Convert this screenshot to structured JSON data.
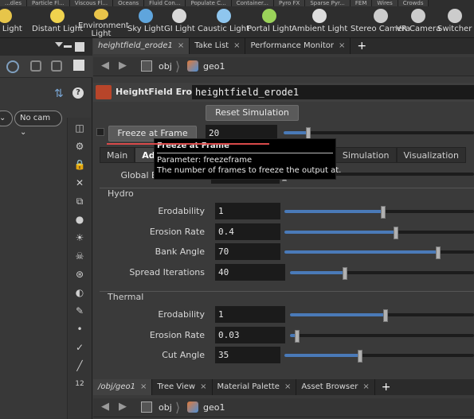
{
  "shelf": {
    "tabs": [
      "...dles",
      "Particle Fl...",
      "Viscous Fl...",
      "Oceans",
      "Fluid Con...",
      "Populate C...",
      "Container...",
      "Pyro FX",
      "Sparse Pyr...",
      "FEM",
      "Wires",
      "Crowds"
    ],
    "tools": [
      {
        "label": "...e Light",
        "icon": "point-light-icon",
        "color": "#e7c54a"
      },
      {
        "label": "Distant Light",
        "icon": "distant-light-icon",
        "color": "#f0d34e"
      },
      {
        "label": "Environment Light",
        "icon": "environment-light-icon",
        "color": "#e9c44a"
      },
      {
        "label": "Sky Light",
        "icon": "sky-light-icon",
        "color": "#5fa5dd"
      },
      {
        "label": "GI Light",
        "icon": "gi-light-icon",
        "color": "#d8d8d8"
      },
      {
        "label": "Caustic Light",
        "icon": "caustic-light-icon",
        "color": "#8fc6ee"
      },
      {
        "label": "Portal Light",
        "icon": "portal-light-icon",
        "color": "#9bd35a"
      },
      {
        "label": "Ambient Light",
        "icon": "ambient-light-icon",
        "color": "#dddddd"
      },
      {
        "label": "Stereo Camera",
        "icon": "stereo-camera-icon",
        "color": "#cccccc"
      },
      {
        "label": "VR Camera",
        "icon": "vr-camera-icon",
        "color": "#cccccc"
      },
      {
        "label": "Switcher",
        "icon": "switcher-icon",
        "color": "#cccccc"
      }
    ]
  },
  "left_pane": {
    "camera_dropdown": "No cam",
    "left_dropdown": ""
  },
  "top_tabs": [
    {
      "label": "heightfield_erode1",
      "active": true
    },
    {
      "label": "Take List",
      "active": false
    },
    {
      "label": "Performance Monitor",
      "active": false
    }
  ],
  "top_path": {
    "seg1": "obj",
    "seg2": "geo1"
  },
  "node": {
    "type_label": "HeightField Erode",
    "name": "heightfield_erode1",
    "accent": "#b8452a"
  },
  "reset_button": "Reset Simulation",
  "freeze": {
    "label": "Freeze at Frame",
    "value": "20",
    "slider": 0.13
  },
  "param_tabs": [
    "Main",
    "Advanced",
    "Simulation",
    "Visualization"
  ],
  "global_label": "Global E",
  "hydro": {
    "title": "Hydro",
    "params": [
      {
        "label": "Erodability",
        "value": "1",
        "slider": 0.52
      },
      {
        "label": "Erosion Rate",
        "value": "0.4",
        "slider": 0.59
      },
      {
        "label": "Bank Angle",
        "value": "70",
        "slider": 0.81
      },
      {
        "label": "Spread Iterations",
        "value": "40",
        "slider": 0.3
      }
    ]
  },
  "thermal": {
    "title": "Thermal",
    "params": [
      {
        "label": "Erodability",
        "value": "1",
        "slider": 0.52
      },
      {
        "label": "Erosion Rate",
        "value": "0.03",
        "slider": 0.04
      },
      {
        "label": "Cut Angle",
        "value": "35",
        "slider": 0.4
      }
    ]
  },
  "tooltip": {
    "title": "Freeze at Frame",
    "line1": "Parameter: freezeframe",
    "line2": "The number of frames to freeze the output at."
  },
  "bottom_tabs": [
    {
      "label": "/obj/geo1",
      "active": true
    },
    {
      "label": "Tree View",
      "active": false
    },
    {
      "label": "Material Palette",
      "active": false
    },
    {
      "label": "Asset Browser",
      "active": false
    }
  ],
  "bottom_path": {
    "seg1": "obj",
    "seg2": "geo1"
  },
  "side_strip_icons": [
    "view-icon",
    "pose-icon",
    "lock-icon",
    "target-icon",
    "tag-icon",
    "bulb-icon",
    "light-bulb-icon",
    "skull-icon",
    "snap-icon",
    "eye-icon",
    "brush-icon",
    "dot-icon",
    "pen-icon",
    "wand-icon",
    "twelve-badge"
  ],
  "strip_bottom_label": "12",
  "colors": {
    "accent_blue": "#4a7ab8",
    "warning_red": "#d94a4a"
  }
}
